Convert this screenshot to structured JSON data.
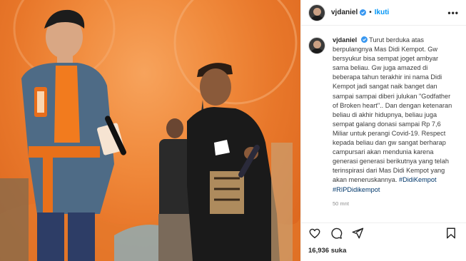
{
  "post": {
    "username": "vjdaniel",
    "separator": "•",
    "follow_label": "Ikuti",
    "more_label": "•••"
  },
  "caption": {
    "username": "vjdaniel",
    "text": "Turut berduka atas berpulangnya Mas Didi Kempot. Gw bersyukur bisa sempat joget ambyar sama beliau. Gw juga amazed di beberapa tahun terakhir ini nama Didi Kempot jadi sangat naik banget dan sampai sampai diberi julukan \"Godfather of Broken heart\".. Dan dengan ketenaran beliau di akhir hidupnya, beliau juga sempat galang donasi sampai Rp 7,6 Miliar untuk perangi Covid-19. Respect kepada beliau dan gw sangat berharap campursari akan mendunia karena generasi generasi berikutnya yang telah terinspirasi dari Mas Didi Kempot yang akan meneruskannya.",
    "hashtags": "#DidiKempot #RIPDidikempot",
    "time": "50 mnt"
  },
  "stats": {
    "likes": "16,936 suka"
  },
  "icons": {
    "like": "heart-icon",
    "comment": "comment-icon",
    "share": "share-icon",
    "save": "bookmark-icon",
    "verified": "verified-badge-icon"
  },
  "colors": {
    "accent": "#0095f6",
    "hashtag": "#00376b",
    "photo_background": "#f08a3c"
  }
}
